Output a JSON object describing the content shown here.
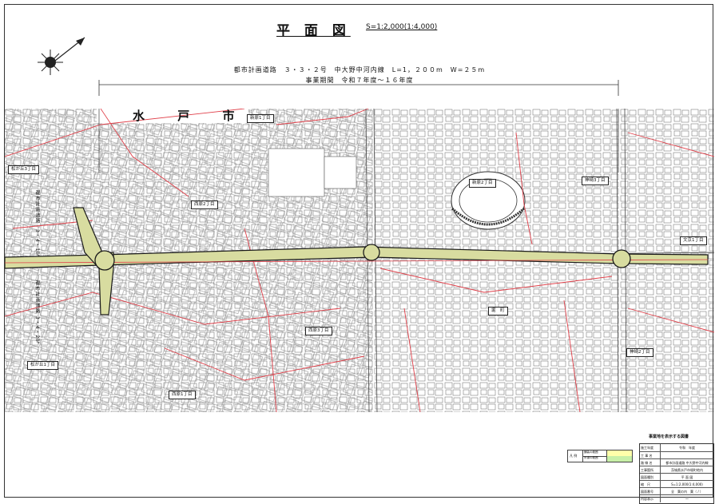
{
  "title": "平 面 図",
  "scale_note": "S=1:2,000(1:4,000)",
  "road_info": "都市計画道路　３・３・２号　中大野中河内線　L=1，２００m　W=２５m",
  "period": "事業期間　令和７年度～１６年度",
  "city_label": "水 戸 市",
  "district_labels": [
    "新原1丁目",
    "西原2丁目",
    "新原2丁目",
    "神崎3丁目",
    "文京1丁目",
    "堀　町",
    "西原3丁目",
    "神崎2丁目",
    "松が丘1丁目",
    "西原1丁目",
    "松が丘3丁目"
  ],
  "vertical_labels": [
    "都市計画道路　3・4・1号",
    "都市計画道路 3・4・2号"
  ],
  "legend": {
    "label": "凡 例",
    "row1": "舗装の範囲",
    "row2": "歩道の範囲",
    "color1": "#ffffaa",
    "color2": "#c8f0a8"
  },
  "title_block": {
    "heading": "事業地を表示する図書",
    "rows": [
      {
        "k": "施工年度",
        "v": "令和　年度"
      },
      {
        "k": "工 事 名",
        "v": ""
      },
      {
        "k": "路 線 名",
        "v": "都市計画道路 中大野中河内線"
      },
      {
        "k": "工事箇所",
        "v": "茨城県水戸市堀町地内"
      },
      {
        "k": "図面種別",
        "v": "平 面 図"
      },
      {
        "k": "縮　尺",
        "v": "S=1:2,000(1:4,000)"
      },
      {
        "k": "図面番号",
        "v": "全　葉の内　葉（ / ）"
      },
      {
        "k": "内容表示",
        "v": "～"
      }
    ]
  },
  "colors": {
    "road_fill": "#d8dca0",
    "road_edge": "#1a1a1a",
    "parcel_red": "#e0404a",
    "map_line": "#555555"
  },
  "north_arrow": "north-arrow-icon"
}
